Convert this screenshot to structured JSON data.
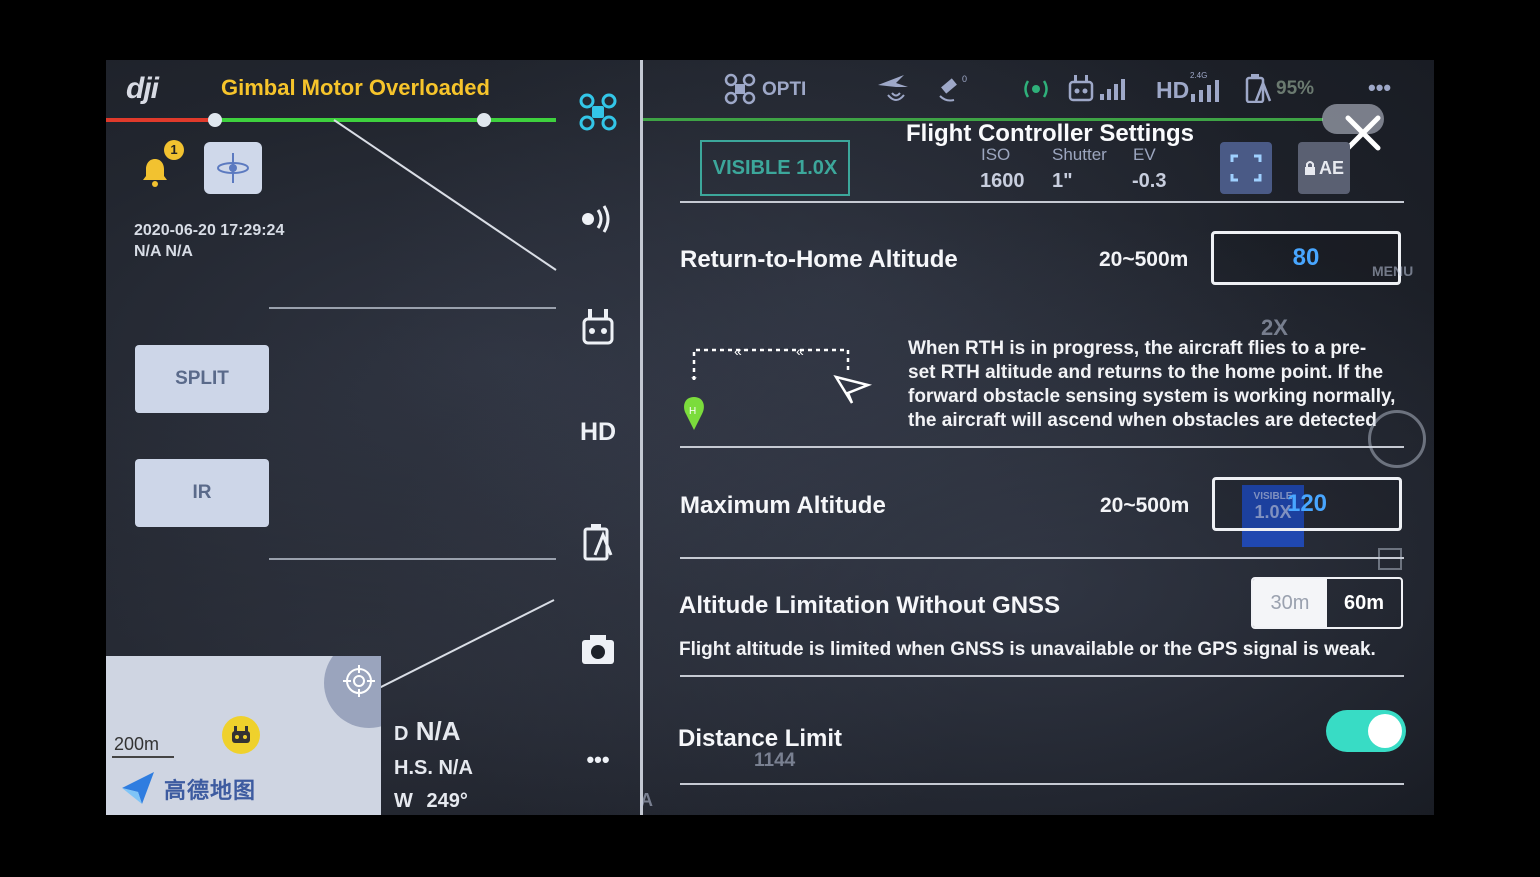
{
  "left": {
    "logo": "dji",
    "warning": "Gimbal Motor Overloaded",
    "notification_count": "1",
    "datetime": "2020-06-20 17:29:24",
    "location": "N/A N/A",
    "split_label": "SPLIT",
    "ir_label": "IR",
    "map": {
      "scale": "200m",
      "brand": "高德地图"
    },
    "telemetry": {
      "d_prefix": "D",
      "d_value": "N/A",
      "hs": "H.S. N/A",
      "heading_prefix": "W",
      "heading_value": "249°"
    }
  },
  "toolbar": {
    "icons": [
      "drone-icon",
      "signal-icon",
      "remote-controller-icon",
      "hd-icon",
      "battery-icon",
      "camera-icon",
      "more-icon"
    ],
    "hd_label": "HD",
    "more_label": "•••"
  },
  "topbar": {
    "mode": "OPTI",
    "hd_label": "HD",
    "hd_band": "2.4G",
    "battery": "95%",
    "more_label": "•••"
  },
  "panel": {
    "title": "Flight Controller Settings",
    "visible_btn": "VISIBLE 1.0X",
    "exposure": {
      "iso_label": "ISO",
      "iso_value": "1600",
      "shutter_label": "Shutter",
      "shutter_value": "1\"",
      "ev_label": "EV",
      "ev_value": "-0.3"
    },
    "ae_label": "AE",
    "rth": {
      "label": "Return-to-Home Altitude",
      "range": "20~500m",
      "value": "80",
      "description_lines": [
        "When RTH is in progress, the aircraft flies to a pre-",
        "set RTH altitude and returns to the home point. If the",
        "forward obstacle sensing system is working normally,",
        "the aircraft will ascend when obstacles are detected"
      ]
    },
    "max_alt": {
      "label": "Maximum Altitude",
      "range": "20~500m",
      "value": "120"
    },
    "gnss": {
      "label": "Altitude Limitation Without GNSS",
      "option_a": "30m",
      "option_b": "60m",
      "selected": "60m",
      "description": "Flight altitude is limited when GNSS is unavailable or the GPS signal is weak."
    },
    "distance_limit": {
      "label": "Distance Limit",
      "enabled": true,
      "ghost_value": "1144"
    },
    "ghost": {
      "menu": "MENU",
      "zoom": "2X",
      "visible_small": "VISIBLE",
      "visible_small_zoom": "1.0X",
      "a_letter": "A"
    }
  },
  "colors": {
    "warning": "#f6c42b",
    "accent_blue": "#48a6ff",
    "toggle_on": "#38dcc5",
    "visible_btn": "#3ca79b",
    "status_green": "#3ed13e",
    "status_red": "#e03a2b"
  }
}
